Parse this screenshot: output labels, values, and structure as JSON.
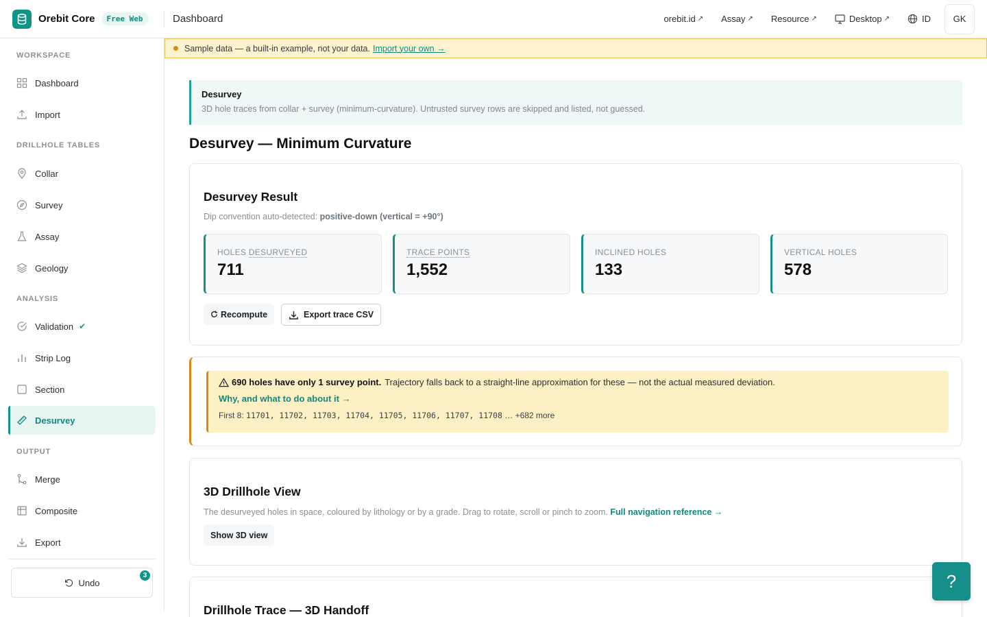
{
  "app": {
    "name": "Orebit Core",
    "badge": "Free Web",
    "page": "Dashboard"
  },
  "topnav": {
    "links": [
      {
        "label": "orebit.id",
        "icon": "external-arrow-icon"
      },
      {
        "label": "Assay",
        "icon": "external-arrow-icon"
      },
      {
        "label": "Resource",
        "icon": "external-arrow-icon"
      },
      {
        "label": "Desktop",
        "icon": "monitor-icon"
      }
    ],
    "lang": "ID",
    "avatar": "GK"
  },
  "sidebar": {
    "sections": {
      "workspace": "WORKSPACE",
      "drillhole": "DRILLHOLE TABLES",
      "analysis": "ANALYSIS",
      "output": "OUTPUT"
    },
    "items": {
      "dashboard": "Dashboard",
      "import": "Import",
      "collar": "Collar",
      "survey": "Survey",
      "assay": "Assay",
      "geology": "Geology",
      "validation": "Validation",
      "striplog": "Strip Log",
      "section": "Section",
      "desurvey": "Desurvey",
      "merge": "Merge",
      "composite": "Composite",
      "export": "Export"
    },
    "undo": {
      "label": "Undo",
      "count": "3"
    }
  },
  "banner": {
    "text": "Sample data — a built-in example, not your data.",
    "link": "Import your own →"
  },
  "info": {
    "title": "Desurvey",
    "subtitle": "3D hole traces from collar + survey (minimum-curvature). Untrusted survey rows are skipped and listed, not guessed."
  },
  "page_title": "Desurvey — Minimum Curvature",
  "result": {
    "title": "Desurvey Result",
    "dip_prefix": "Dip convention auto-detected:",
    "dip_value": "positive-down (vertical = +90°)",
    "stats": [
      {
        "label_a": "HOLES ",
        "label_b": "DESURVEYED",
        "value": "711"
      },
      {
        "label_a": "",
        "label_b": "TRACE POINTS",
        "value": "1,552"
      },
      {
        "label_a": "INCLINED HOLES",
        "label_b": "",
        "value": "133"
      },
      {
        "label_a": "VERTICAL HOLES",
        "label_b": "",
        "value": "578"
      }
    ],
    "recompute": "Recompute",
    "export": "Export trace CSV"
  },
  "warning": {
    "bold": "690 holes have only 1 survey point.",
    "text": "Trajectory falls back to a straight-line approximation for these — not the actual measured deviation.",
    "link": "Why, and what to do about it →",
    "list_prefix": "First 8:",
    "list": "11701, 11702, 11703, 11704, 11705, 11706, 11707, 11708",
    "more": "… +682 more"
  },
  "view3d": {
    "title": "3D Drillhole View",
    "desc": "The desurveyed holes in space, coloured by lithology or by a grade. Drag to rotate, scroll or pinch to zoom.",
    "link": "Full navigation reference →",
    "button": "Show 3D view"
  },
  "handoff": {
    "title": "Drillhole Trace — 3D Handoff"
  },
  "help": "?",
  "colors": {
    "accent": "#0f9488",
    "warning": "#e0841a",
    "banner": "#fdf3cf"
  }
}
